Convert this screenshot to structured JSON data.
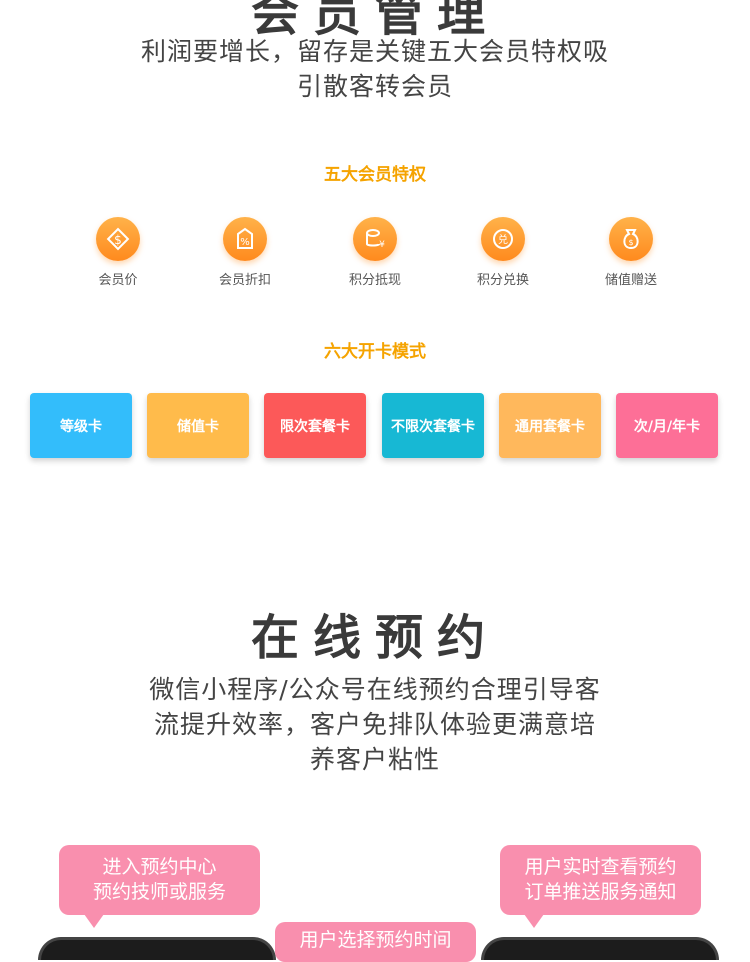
{
  "member_section": {
    "title_partial": "会员管理",
    "description_line1": "利润要增长，留存是关键五大会员特权吸",
    "description_line2": "引散客转会员",
    "privileges_title": "五大会员特权",
    "privileges": [
      {
        "label": "会员价",
        "icon": "dollar-tag-icon"
      },
      {
        "label": "会员折扣",
        "icon": "percent-tag-icon"
      },
      {
        "label": "积分抵现",
        "icon": "coin-stack-icon"
      },
      {
        "label": "积分兑换",
        "icon": "exchange-badge-icon"
      },
      {
        "label": "储值赠送",
        "icon": "money-bag-icon"
      }
    ],
    "card_modes_title": "六大开卡模式",
    "card_modes": [
      {
        "label": "等级卡",
        "color": "#33bdfb"
      },
      {
        "label": "储值卡",
        "color": "#ffbb4b"
      },
      {
        "label": "限次套餐卡",
        "color": "#fc5959"
      },
      {
        "label": "不限次套餐卡",
        "color": "#17b8d4"
      },
      {
        "label": "通用套餐卡",
        "color": "#ffb85c"
      },
      {
        "label": "次/月/年卡",
        "color": "#fd6f97"
      }
    ]
  },
  "booking_section": {
    "title": "在线预约",
    "description_line1": "微信小程序/公众号在线预约合理引导客",
    "description_line2": "流提升效率，客户免排队体验更满意培",
    "description_line3": "养客户粘性",
    "bubbles": [
      {
        "line1": "进入预约中心",
        "line2": "预约技师或服务"
      },
      {
        "line1": "用户选择预约时间",
        "line2": ""
      },
      {
        "line1": "用户实时查看预约",
        "line2": "订单推送服务通知"
      }
    ]
  }
}
